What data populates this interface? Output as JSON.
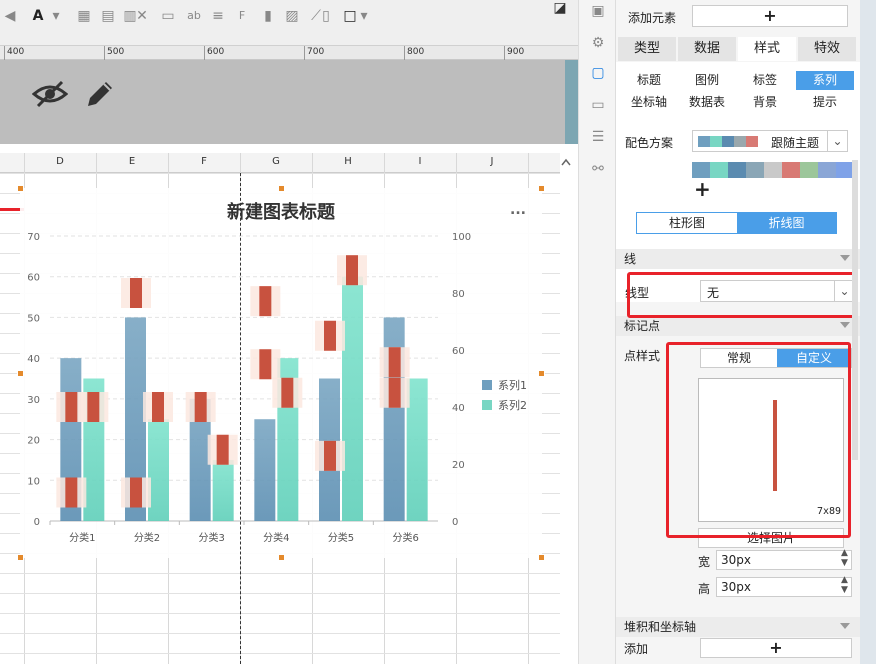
{
  "ruler": {
    "ticks": [
      "400",
      "500",
      "600",
      "700",
      "800",
      "900"
    ]
  },
  "column_headers": [
    "D",
    "E",
    "F",
    "G",
    "H",
    "I",
    "J"
  ],
  "panel": {
    "add_element_label": "添加元素",
    "add_element_btn": "+",
    "tabs": [
      "类型",
      "数据",
      "样式",
      "特效"
    ],
    "active_tab": "样式",
    "subtabs_row1": [
      "标题",
      "图例",
      "标签",
      "系列"
    ],
    "subtabs_row2": [
      "坐标轴",
      "数据表",
      "背景",
      "提示"
    ],
    "active_subtab": "系列",
    "color_scheme_label": "配色方案",
    "color_scheme_value": "跟随主题",
    "palette": [
      "#6f9fbf",
      "#78d6c3",
      "#5b8bb0",
      "#8aa6b6",
      "#c9c9c9",
      "#d87a74",
      "#9cc69a",
      "#8aa6d6",
      "#7fa2e8"
    ],
    "add_color": "+",
    "chart_type_tabs": [
      "柱形图",
      "折线图"
    ],
    "active_chart_type": "折线图",
    "line_section": "线",
    "line_type_label": "线型",
    "line_type_value": "无",
    "marker_section": "标记点",
    "point_style_label": "点样式",
    "point_style_tabs": [
      "常规",
      "自定义"
    ],
    "active_point_style": "自定义",
    "image_size": "7x89",
    "choose_image": "选择图片",
    "width_label": "宽",
    "width_value": "30px",
    "height_label": "高",
    "height_value": "30px",
    "stack_section": "堆积和坐标轴",
    "add_label": "添加",
    "add_btn": "+"
  },
  "colors": {
    "accent": "#4a9ee8",
    "highlight": "#e8222a",
    "series1": "#6f9fbf",
    "series2": "#78d6c3",
    "marker": "#c8523f"
  },
  "chart_data": {
    "type": "bar",
    "title": "新建图表标题",
    "categories": [
      "分类1",
      "分类2",
      "分类3",
      "分类4",
      "分类5",
      "分类6"
    ],
    "series": [
      {
        "name": "系列1",
        "values": [
          40,
          50,
          30,
          25,
          35,
          50
        ]
      },
      {
        "name": "系列2",
        "values": [
          35,
          25,
          15,
          40,
          60,
          35
        ]
      }
    ],
    "markers": {
      "left_axis_values": [
        28,
        7,
        28,
        54,
        16,
        39
      ],
      "right_axis_values": [
        40,
        10,
        40,
        80,
        25,
        55,
        45,
        65,
        88,
        45
      ],
      "note": ""
    },
    "left_axis": {
      "ticks": [
        "0",
        "10",
        "20",
        "30",
        "40",
        "50",
        "60",
        "70"
      ],
      "ylim": [
        0,
        70
      ]
    },
    "right_axis": {
      "ticks": [
        "0",
        "20",
        "40",
        "60",
        "80",
        "100"
      ],
      "ylim": [
        0,
        100
      ]
    },
    "legend": [
      "系列1",
      "系列2"
    ],
    "legend_position": "right",
    "grid": true,
    "menu_icon": "..."
  }
}
